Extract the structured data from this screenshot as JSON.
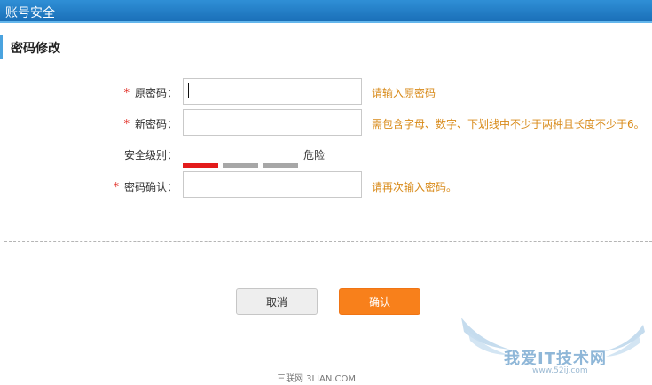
{
  "window": {
    "title": "账号安全"
  },
  "section": {
    "title": "密码修改"
  },
  "form": {
    "required_mark": "*",
    "old_password": {
      "label": "原密码：",
      "value": "",
      "hint": "请输入原密码"
    },
    "new_password": {
      "label": "新密码：",
      "value": "",
      "hint": "需包含字母、数字、下划线中不少于两种且长度不少于6。"
    },
    "strength": {
      "label": "安全级别：",
      "level_text": "危险",
      "level_fraction": 0.33
    },
    "confirm_password": {
      "label": "密码确认：",
      "value": "",
      "hint": "请再次输入密码。"
    }
  },
  "buttons": {
    "cancel": "取消",
    "confirm": "确认"
  },
  "footer": {
    "text": "三联网 3LIAN.COM"
  },
  "watermark": {
    "text": "我爱IT技术网",
    "url": "www.52ij.com"
  },
  "colors": {
    "titlebar": "#1a6fb8",
    "hint": "#d88a19",
    "required": "#e0241b",
    "danger_bar": "#e31b1b",
    "confirm_button": "#f8801b"
  }
}
